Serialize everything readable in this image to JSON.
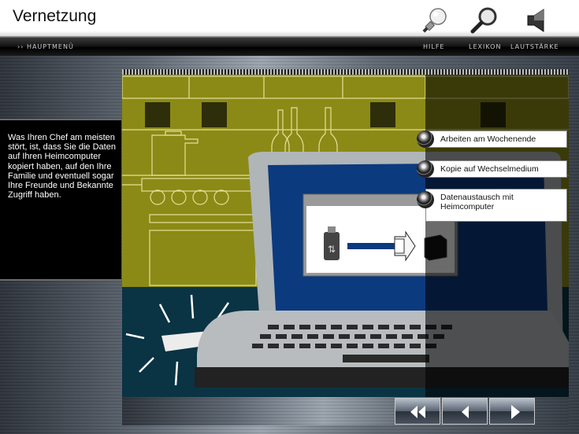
{
  "header": {
    "title": "Vernetzung"
  },
  "nav": {
    "home": "›› HAUPTMENÜ",
    "help": "HILFE",
    "lexicon": "LEXIKON",
    "volume": "LAUTSTÄRKE"
  },
  "info": {
    "text": "Was Ihren Chef am meisten stört, ist, dass Sie die Daten auf Ihren Heimcomputer kopiert haben, auf den Ihre Familie und eventuell sogar Ihre Freunde und Bekannte Zugriff haben."
  },
  "options": [
    {
      "label": "Arbeiten am Wochenende"
    },
    {
      "label": "Kopie auf Wechselmedium"
    },
    {
      "label": "Datenaustausch mit Heimcomputer"
    }
  ],
  "icons": {
    "help": "lightbulb-icon",
    "lexicon": "magnifier-icon",
    "volume": "speaker-icon",
    "back_fast": "double-left-arrow-icon",
    "back": "left-arrow-icon",
    "forward": "right-arrow-icon"
  },
  "colors": {
    "kitchen": "#8b8a16",
    "laptop_screen": "#0b3a7e",
    "scene_floor": "#0a3344"
  }
}
